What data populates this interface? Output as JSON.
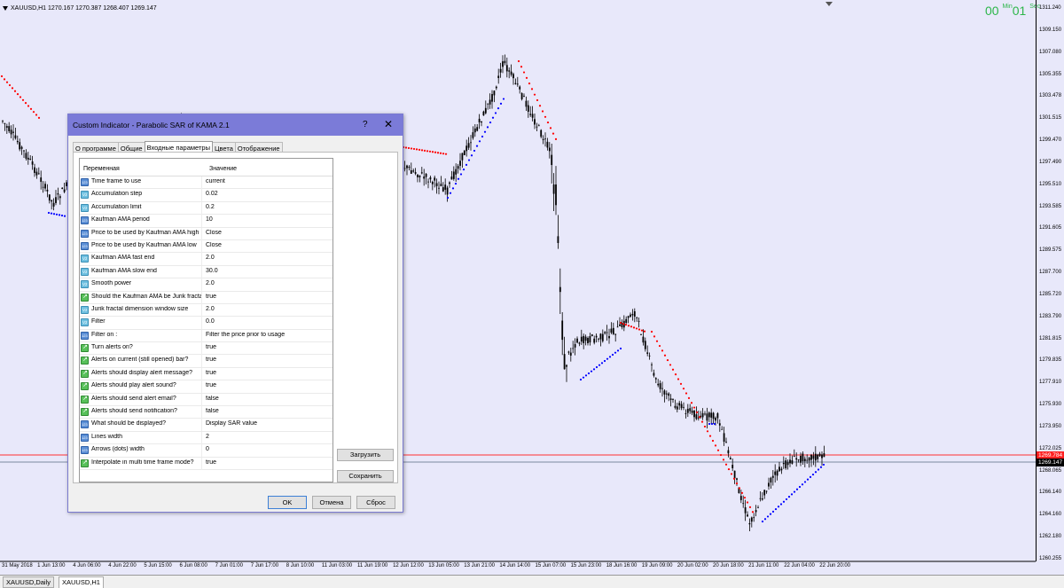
{
  "chart": {
    "title": "XAUUSD,H1  1270.167 1270.387 1268.407 1269.147",
    "timer": {
      "value1": "00",
      "unit1": "Min",
      "value2": "01",
      "unit2": "Sec"
    },
    "price_labels": [
      "1311.240",
      "1309.150",
      "1307.080",
      "1305.355",
      "1303.478",
      "1301.515",
      "1299.470",
      "1297.490",
      "1295.510",
      "1293.585",
      "1291.605",
      "1289.575",
      "1287.700",
      "1285.720",
      "1283.790",
      "1281.815",
      "1279.835",
      "1277.910",
      "1275.930",
      "1273.950",
      "1272.025",
      "1268.065",
      "1266.140",
      "1264.160",
      "1262.180",
      "1260.255"
    ],
    "bid_tag": "1269.784",
    "ask_tag": "1269.147",
    "time_labels": [
      "31 May 2018",
      "1 Jun 13:00",
      "4 Jun 06:00",
      "4 Jun 22:00",
      "5 Jun 15:00",
      "6 Jun 08:00",
      "7 Jun 01:00",
      "7 Jun 17:00",
      "8 Jun 10:00",
      "11 Jun 03:00",
      "11 Jun 19:00",
      "12 Jun 12:00",
      "13 Jun 05:00",
      "13 Jun 21:00",
      "14 Jun 14:00",
      "15 Jun 07:00",
      "15 Jun 23:00",
      "18 Jun 16:00",
      "19 Jun 09:00",
      "20 Jun 02:00",
      "20 Jun 18:00",
      "21 Jun 11:00",
      "22 Jun 04:00",
      "22 Jun 20:00"
    ],
    "colors": {
      "background": "#e8e8fa",
      "candle": "#000000",
      "sar_up": "#0000ff",
      "sar_down": "#ff0000",
      "bid_line": "#ff3030",
      "ask_line": "#7a8aa0",
      "timer": "#2db64a"
    }
  },
  "bottom_tabs": [
    "XAUUSD,Daily",
    "XAUUSD,H1"
  ],
  "dialog": {
    "title": "Custom Indicator - Parabolic SAR of KAMA 2.1",
    "help": "?",
    "close": "✕",
    "tabs": [
      "О программе",
      "Общие",
      "Входные параметры",
      "Цвета",
      "Отображение"
    ],
    "active_tab": "Входные параметры",
    "columns": {
      "name": "Переменная",
      "value": "Значение"
    },
    "params": [
      {
        "name": "Time frame to use",
        "value": "current",
        "icon": "123"
      },
      {
        "name": "Accumulation step",
        "value": "0.02",
        "icon": "v2"
      },
      {
        "name": "Accumulation limit",
        "value": "0.2",
        "icon": "v2"
      },
      {
        "name": "Kaufman AMA period",
        "value": "10",
        "icon": "123"
      },
      {
        "name": "Price to be used by Kaufman AMA high",
        "value": "Close",
        "icon": "123"
      },
      {
        "name": "Price to be used by Kaufman AMA low",
        "value": "Close",
        "icon": "123"
      },
      {
        "name": "Kaufman AMA fast end",
        "value": "2.0",
        "icon": "v2"
      },
      {
        "name": "Kaufman AMA slow end",
        "value": "30.0",
        "icon": "v2"
      },
      {
        "name": "Smooth power",
        "value": "2.0",
        "icon": "v2"
      },
      {
        "name": "Should the Kaufman AMA be Jurik fracta...",
        "value": "true",
        "icon": "bool"
      },
      {
        "name": "Jurik fractal dimension window size",
        "value": "2.0",
        "icon": "v2"
      },
      {
        "name": "Filter",
        "value": "0.0",
        "icon": "v2"
      },
      {
        "name": "Filter on :",
        "value": "Filter the price prior to usage",
        "icon": "123"
      },
      {
        "name": "Turn alerts on?",
        "value": "true",
        "icon": "bool"
      },
      {
        "name": "Alerts on current (still opened) bar?",
        "value": "true",
        "icon": "bool"
      },
      {
        "name": "Alerts should display alert message?",
        "value": "true",
        "icon": "bool"
      },
      {
        "name": "Alerts should play alert sound?",
        "value": "true",
        "icon": "bool"
      },
      {
        "name": "Alerts should send alert email?",
        "value": "false",
        "icon": "bool"
      },
      {
        "name": "Alerts should send notification?",
        "value": "false",
        "icon": "bool"
      },
      {
        "name": "What should be displayed?",
        "value": "Display SAR value",
        "icon": "123"
      },
      {
        "name": "Lines width",
        "value": "2",
        "icon": "123"
      },
      {
        "name": "Arrows (dots) width",
        "value": "0",
        "icon": "123"
      },
      {
        "name": "Interpolate in multi time frame mode?",
        "value": "true",
        "icon": "bool"
      }
    ],
    "load_button": "Загрузить",
    "save_button": "Сохранить",
    "ok_button": "OK",
    "cancel_button": "Отмена",
    "reset_button": "Сброс"
  }
}
